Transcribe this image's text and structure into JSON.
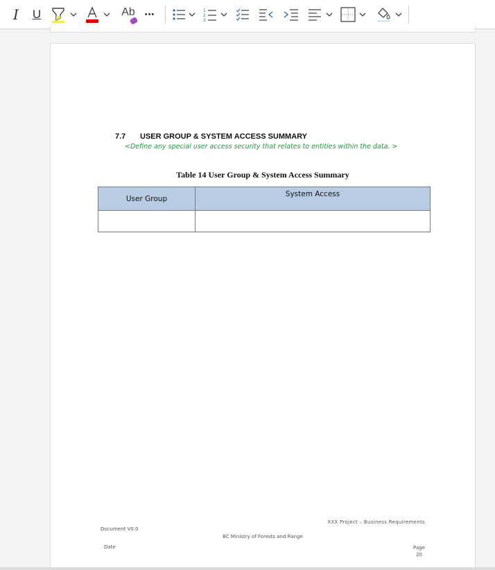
{
  "colors": {
    "highlight": "#f6e84a",
    "font_color": "#e00000",
    "guidance_text": "#1a9b3c",
    "table_header": "#b8cce4"
  },
  "toolbar": {
    "italic_label": "I",
    "underline_label": "U",
    "text_effects_label": "Ab",
    "more_label": "•••",
    "icons": [
      "italic-icon",
      "underline-icon",
      "highlight-icon",
      "font-color-icon",
      "text-effects-icon",
      "more-icon",
      "bullets-icon",
      "numbering-icon",
      "checklist-icon",
      "decrease-indent-icon",
      "increase-indent-icon",
      "align-icon",
      "borders-icon",
      "shading-icon"
    ]
  },
  "document": {
    "section_number": "7.7",
    "section_title": "USER GROUP & SYSTEM ACCESS SUMMARY",
    "guidance": "<Define any special user access security that relates to entities within the data. >",
    "table_caption": "Table 14 User Group & System Access Summary",
    "table": {
      "headers": [
        "User Group",
        "System Access"
      ],
      "rows": [
        [
          "",
          ""
        ]
      ]
    },
    "footer": {
      "project": "XXX Project  –  Business Requirements",
      "document_version": "Document V0.0",
      "organization": "BC Ministry of Forests and Range",
      "date_label": "Date",
      "page_label": "Page",
      "page_number": "20"
    }
  }
}
